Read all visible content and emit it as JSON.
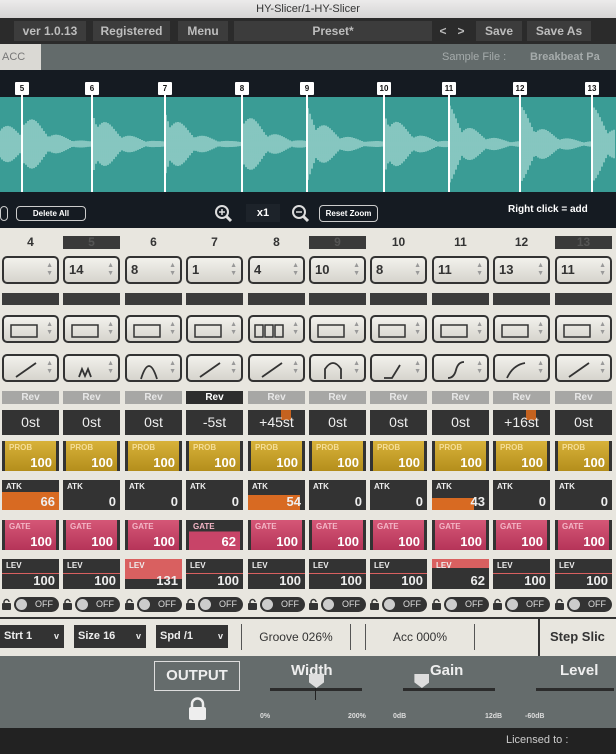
{
  "window": {
    "title": "HY-Slicer/1-HY-Slicer"
  },
  "topbar": {
    "version": "ver 1.0.13",
    "registered": "Registered",
    "menu": "Menu",
    "preset": "Preset*",
    "prev": "<",
    "next": ">",
    "save": "Save",
    "save_as": "Save As"
  },
  "samplebar": {
    "acc_tab": "ACC",
    "sample_label": "Sample File :",
    "sample_file": "Breakbeat Pa"
  },
  "markers": [
    "5",
    "6",
    "7",
    "8",
    "9",
    "10",
    "11",
    "12",
    "13"
  ],
  "toolbar": {
    "delete_all": "Delete All",
    "zoom_level": "x1",
    "reset_zoom": "Reset Zoom",
    "hint": "Right click = add"
  },
  "columns": [
    {
      "num": "4",
      "hl": false,
      "sel": "",
      "mode": "rect",
      "env": "line",
      "rev": false,
      "pitch": "0st",
      "prob": "100",
      "atk": "66",
      "gate": "100",
      "lev": "100",
      "toggle": "OFF"
    },
    {
      "num": "5",
      "hl": true,
      "sel": "14",
      "mode": "rect",
      "env": "m",
      "rev": false,
      "pitch": "0st",
      "prob": "100",
      "atk": "0",
      "gate": "100",
      "lev": "100",
      "toggle": "OFF"
    },
    {
      "num": "6",
      "hl": false,
      "sel": "8",
      "mode": "rect",
      "env": "bell",
      "rev": false,
      "pitch": "0st",
      "prob": "100",
      "atk": "0",
      "gate": "100",
      "lev": "131",
      "toggle": "OFF"
    },
    {
      "num": "7",
      "hl": false,
      "sel": "1",
      "mode": "rect",
      "env": "line",
      "rev": true,
      "pitch": "-5st",
      "prob": "100",
      "atk": "0",
      "gate": "62",
      "lev": "100",
      "toggle": "OFF"
    },
    {
      "num": "8",
      "hl": false,
      "sel": "4",
      "mode": "triple",
      "env": "line",
      "rev": false,
      "pitch": "+45st",
      "prob": "100",
      "atk": "54",
      "gate": "100",
      "lev": "100",
      "toggle": "OFF"
    },
    {
      "num": "9",
      "hl": true,
      "sel": "10",
      "mode": "rect",
      "env": "arch",
      "rev": false,
      "pitch": "0st",
      "prob": "100",
      "atk": "0",
      "gate": "100",
      "lev": "100",
      "toggle": "OFF"
    },
    {
      "num": "10",
      "hl": false,
      "sel": "8",
      "mode": "rect",
      "env": "hockey",
      "rev": false,
      "pitch": "0st",
      "prob": "100",
      "atk": "0",
      "gate": "100",
      "lev": "100",
      "toggle": "OFF"
    },
    {
      "num": "11",
      "hl": false,
      "sel": "11",
      "mode": "rect",
      "env": "scurve",
      "rev": false,
      "pitch": "0st",
      "prob": "100",
      "atk": "43",
      "gate": "100",
      "lev": "62",
      "toggle": "OFF"
    },
    {
      "num": "12",
      "hl": false,
      "sel": "13",
      "mode": "rect",
      "env": "curve",
      "rev": false,
      "pitch": "+16st",
      "prob": "100",
      "atk": "0",
      "gate": "100",
      "lev": "100",
      "toggle": "OFF"
    },
    {
      "num": "13",
      "hl": true,
      "sel": "11",
      "mode": "rect",
      "env": "line",
      "rev": false,
      "pitch": "0st",
      "prob": "100",
      "atk": "0",
      "gate": "100",
      "lev": "100",
      "toggle": "OFF"
    }
  ],
  "labels": {
    "rev": "Rev",
    "prob": "PROB",
    "atk": "ATK",
    "gate": "GATE",
    "lev": "LEV"
  },
  "stepbar": {
    "start": "Strt 1",
    "size": "Size 16",
    "speed": "Spd /1",
    "groove": "Groove 026%",
    "acc": "Acc 000%",
    "step_slice": "Step Slic"
  },
  "output": {
    "title": "OUTPUT",
    "width_label": "Width",
    "width_min": "0%",
    "width_max": "200%",
    "width_value": 0.5,
    "gain_label": "Gain",
    "gain_min": "0dB",
    "gain_max": "12dB",
    "gain_value": 0.2,
    "level_label": "Level",
    "level_min": "-60dB"
  },
  "footer": {
    "licensed": "Licensed to :"
  },
  "colors": {
    "wave": "#3a9c95",
    "prob": "#c9a22c",
    "gate": "#c84468",
    "atk_fill": "#d86a22",
    "lev_fill": "#d96060"
  }
}
